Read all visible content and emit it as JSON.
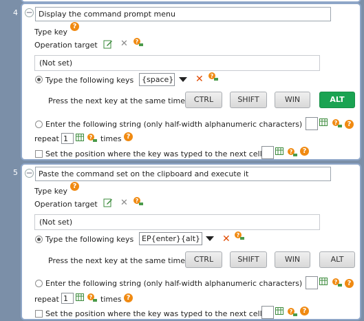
{
  "steps": [
    {
      "number": "4",
      "title": "Display the command prompt menu",
      "type_key_label": "Type key",
      "operation_target_label": "Operation target",
      "target_value": "(Not set)",
      "type_keys_label": "Type the following keys",
      "keys_value": "{space}",
      "modifier_label": "Press the next key at the same time",
      "modifiers": [
        {
          "label": "CTRL",
          "active": false
        },
        {
          "label": "SHIFT",
          "active": false
        },
        {
          "label": "WIN",
          "active": false
        },
        {
          "label": "ALT",
          "active": true
        }
      ],
      "enter_string_label": "Enter the following string (only half-width alphanumeric characters)",
      "repeat_label": "repeat",
      "repeat_value": "1",
      "times_label": "times",
      "set_position_label": "Set the position where the key was typed to the next cell"
    },
    {
      "number": "5",
      "title": "Paste the command set on the clipboard and execute it",
      "type_key_label": "Type key",
      "operation_target_label": "Operation target",
      "target_value": "(Not set)",
      "type_keys_label": "Type the following keys",
      "keys_value": "EP{enter}{alt}",
      "modifier_label": "Press the next key at the same time",
      "modifiers": [
        {
          "label": "CTRL",
          "active": false
        },
        {
          "label": "SHIFT",
          "active": false
        },
        {
          "label": "WIN",
          "active": false
        },
        {
          "label": "ALT",
          "active": false
        }
      ],
      "enter_string_label": "Enter the following string (only half-width alphanumeric characters)",
      "repeat_label": "repeat",
      "repeat_value": "1",
      "times_label": "times",
      "set_position_label": "Set the position where the key was typed to the next cell"
    }
  ],
  "colors": {
    "background": "#7b8fa8",
    "panel_border": "#8ea6c8",
    "help_icon": "#f08a12",
    "clear_icon": "#e04a00",
    "active_modifier": "#1aa352"
  },
  "icons": [
    "collapse-icon",
    "help-icon",
    "edit-icon",
    "clear-icon",
    "key-search-icon",
    "dropdown-icon",
    "table-icon"
  ]
}
